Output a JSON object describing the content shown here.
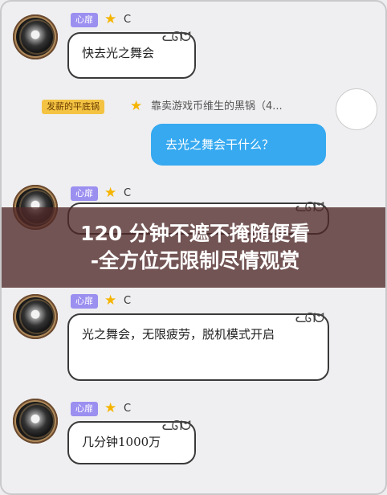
{
  "messages": [
    {
      "tag": "心扉",
      "letter": "C",
      "text": "快去光之舞会"
    },
    {
      "tag": "心扉",
      "letter": "C"
    },
    {
      "tag": "心扉",
      "letter": "C",
      "text": "光之舞会，无限疲劳，脱机模式开启"
    },
    {
      "tag": "心扉",
      "letter": "C",
      "text": "几分钟1000万"
    }
  ],
  "system_line": {
    "tag": "发薪的平底锅",
    "text": "靠卖游戏币维生的黑锅（4..."
  },
  "outgoing": {
    "text": "去光之舞会干什么？"
  },
  "overlay": {
    "line1": "120 分钟不遮不掩随便看",
    "line2": "-全方位无限制尽情观赏"
  },
  "colors": {
    "accent_blue": "#36a9f0",
    "tag_purple": "#9b8ff0",
    "tag_orange": "#f4c343",
    "overlay": "#5a2d2d"
  }
}
